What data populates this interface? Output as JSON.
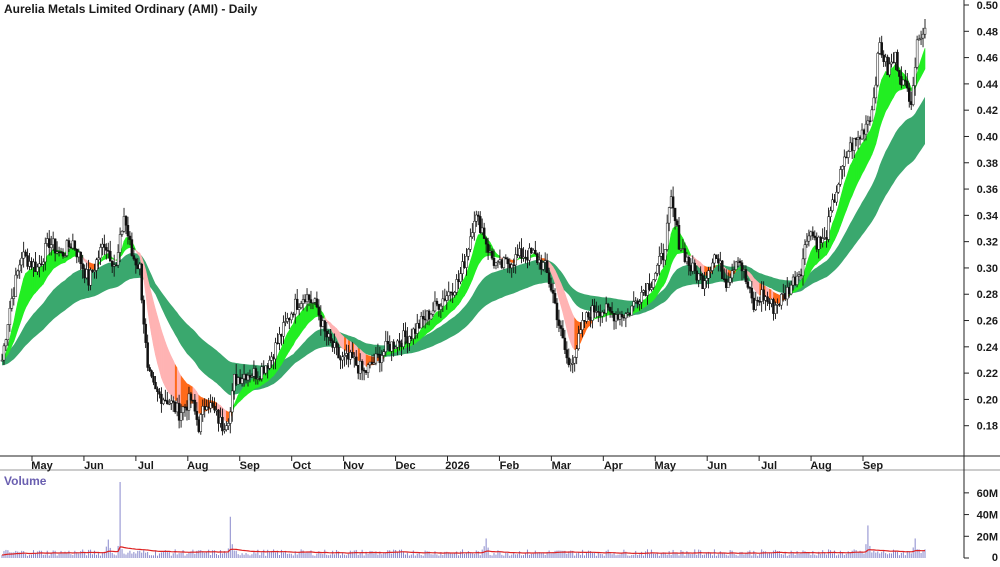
{
  "chart_data": {
    "type": "candlestick",
    "title": "Aurelia Metals Limited Ordinary (AMI) - Daily",
    "ylim": [
      0.16,
      0.5
    ],
    "y_ticks": [
      "0.18",
      "0.20",
      "0.22",
      "0.24",
      "0.26",
      "0.28",
      "0.30",
      "0.32",
      "0.34",
      "0.36",
      "0.38",
      "0.40",
      "0.42",
      "0.44",
      "0.46",
      "0.48",
      "0.50"
    ],
    "x_labels": [
      "May",
      "Jun",
      "Jul",
      "Aug",
      "Sep",
      "Oct",
      "Nov",
      "Dec",
      "2026",
      "Feb",
      "Mar",
      "Apr",
      "May",
      "Jun",
      "Jul",
      "Aug",
      "Sep"
    ],
    "price_anchors": [
      [
        0,
        0.23
      ],
      [
        4,
        0.27
      ],
      [
        10,
        0.31
      ],
      [
        18,
        0.3
      ],
      [
        24,
        0.32
      ],
      [
        30,
        0.31
      ],
      [
        36,
        0.32
      ],
      [
        44,
        0.29
      ],
      [
        52,
        0.32
      ],
      [
        58,
        0.3
      ],
      [
        62,
        0.34
      ],
      [
        66,
        0.31
      ],
      [
        70,
        0.3
      ],
      [
        72,
        0.26
      ],
      [
        74,
        0.22
      ],
      [
        78,
        0.205
      ],
      [
        84,
        0.2
      ],
      [
        90,
        0.19
      ],
      [
        96,
        0.2
      ],
      [
        100,
        0.18
      ],
      [
        104,
        0.2
      ],
      [
        108,
        0.19
      ],
      [
        112,
        0.18
      ],
      [
        116,
        0.19
      ],
      [
        118,
        0.215
      ],
      [
        124,
        0.22
      ],
      [
        130,
        0.22
      ],
      [
        136,
        0.23
      ],
      [
        142,
        0.25
      ],
      [
        148,
        0.27
      ],
      [
        154,
        0.28
      ],
      [
        160,
        0.27
      ],
      [
        164,
        0.25
      ],
      [
        168,
        0.24
      ],
      [
        172,
        0.23
      ],
      [
        178,
        0.23
      ],
      [
        184,
        0.22
      ],
      [
        190,
        0.23
      ],
      [
        196,
        0.24
      ],
      [
        202,
        0.245
      ],
      [
        208,
        0.25
      ],
      [
        214,
        0.26
      ],
      [
        220,
        0.27
      ],
      [
        226,
        0.28
      ],
      [
        232,
        0.29
      ],
      [
        236,
        0.31
      ],
      [
        240,
        0.34
      ],
      [
        244,
        0.33
      ],
      [
        248,
        0.31
      ],
      [
        252,
        0.3
      ],
      [
        258,
        0.305
      ],
      [
        264,
        0.31
      ],
      [
        270,
        0.31
      ],
      [
        276,
        0.3
      ],
      [
        280,
        0.28
      ],
      [
        284,
        0.25
      ],
      [
        288,
        0.225
      ],
      [
        292,
        0.24
      ],
      [
        296,
        0.26
      ],
      [
        302,
        0.27
      ],
      [
        310,
        0.265
      ],
      [
        318,
        0.265
      ],
      [
        324,
        0.28
      ],
      [
        330,
        0.29
      ],
      [
        336,
        0.31
      ],
      [
        340,
        0.35
      ],
      [
        344,
        0.32
      ],
      [
        350,
        0.3
      ],
      [
        356,
        0.29
      ],
      [
        362,
        0.31
      ],
      [
        368,
        0.29
      ],
      [
        374,
        0.31
      ],
      [
        378,
        0.29
      ],
      [
        382,
        0.27
      ],
      [
        386,
        0.28
      ],
      [
        392,
        0.27
      ],
      [
        398,
        0.28
      ],
      [
        402,
        0.29
      ],
      [
        406,
        0.3
      ],
      [
        410,
        0.33
      ],
      [
        414,
        0.32
      ],
      [
        418,
        0.32
      ],
      [
        424,
        0.36
      ],
      [
        430,
        0.39
      ],
      [
        436,
        0.4
      ],
      [
        442,
        0.42
      ],
      [
        446,
        0.47
      ],
      [
        450,
        0.45
      ],
      [
        454,
        0.46
      ],
      [
        458,
        0.44
      ],
      [
        462,
        0.43
      ],
      [
        466,
        0.48
      ]
    ],
    "volume_label": "Volume",
    "volume_ticks": [
      "0",
      "20M",
      "40M",
      "60M"
    ],
    "volume_ylim": [
      0,
      70
    ],
    "volume_spikes": [
      [
        54,
        17
      ],
      [
        60,
        70
      ],
      [
        116,
        38
      ],
      [
        246,
        18
      ],
      [
        440,
        30
      ],
      [
        464,
        18
      ]
    ],
    "ma_colors": {
      "short_up": "#22ee22",
      "short_down": "#ff6a1a",
      "short_down_decline": "#ffb3b3",
      "long_band": "#3aa86e",
      "volume_bar": "#8888cc",
      "volume_ma": "#dd2222"
    }
  }
}
